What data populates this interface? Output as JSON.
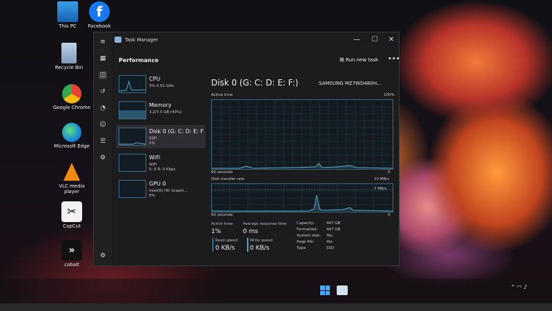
{
  "desktop": {
    "icons": [
      {
        "label": "This PC",
        "icon": "monitor-icon"
      },
      {
        "label": "Facebook",
        "icon": "facebook-icon"
      },
      {
        "label": "Recycle Bin",
        "icon": "recycle-bin-icon"
      },
      {
        "label": "Google Chrome",
        "icon": "chrome-icon"
      },
      {
        "label": "Microsoft Edge",
        "icon": "edge-icon"
      },
      {
        "label": "VLC media player",
        "icon": "vlc-icon"
      },
      {
        "label": "CapCut",
        "icon": "capcut-icon"
      },
      {
        "label": "cobalt",
        "icon": "cobalt-icon"
      }
    ]
  },
  "window": {
    "title": "Task Manager",
    "header": "Performance",
    "run_new_task": "Run new task",
    "more": "•••"
  },
  "perf_items": [
    {
      "name": "CPU",
      "sub1": "3% 0.51 GHz",
      "sub2": ""
    },
    {
      "name": "Memory",
      "sub1": "3.2/7.5 GB (43%)",
      "sub2": ""
    },
    {
      "name": "Disk 0 (G: C: D: E: F",
      "sub1": "SSD",
      "sub2": "1%"
    },
    {
      "name": "WiFi",
      "sub1": "WiFi",
      "sub2": "S: 0 R: 0 Kbps"
    },
    {
      "name": "GPU 0",
      "sub1": "Intel(R) HD Graphi...",
      "sub2": "0%"
    }
  ],
  "detail": {
    "title": "Disk 0 (G: C: D: E: F:)",
    "model": "SAMSUNG MZ7WD480H...",
    "active_time_label": "Active time",
    "active_time_max": "100%",
    "graph1_time": "60 seconds",
    "graph1_min": "0",
    "transfer_label": "Disk transfer rate",
    "transfer_max": "10 MB/s",
    "transfer_mark": "7 MB/s",
    "graph2_time": "60 seconds",
    "graph2_min": "0",
    "stats": {
      "active_time_label": "Active time",
      "active_time_value": "1%",
      "avg_response_label": "Average response time",
      "avg_response_value": "0 ms",
      "read_label": "Read speed",
      "read_value": "0 KB/s",
      "write_label": "Write speed",
      "write_value": "0 KB/s"
    },
    "props": [
      {
        "key": "Capacity:",
        "value": "447 GB"
      },
      {
        "key": "Formatted:",
        "value": "447 GB"
      },
      {
        "key": "System disk:",
        "value": "Yes"
      },
      {
        "key": "Page file:",
        "value": "Yes"
      },
      {
        "key": "Type:",
        "value": "SSD"
      }
    ]
  },
  "colors": {
    "accent": "#5aa7c8",
    "window_bg": "#1c1c1e"
  }
}
